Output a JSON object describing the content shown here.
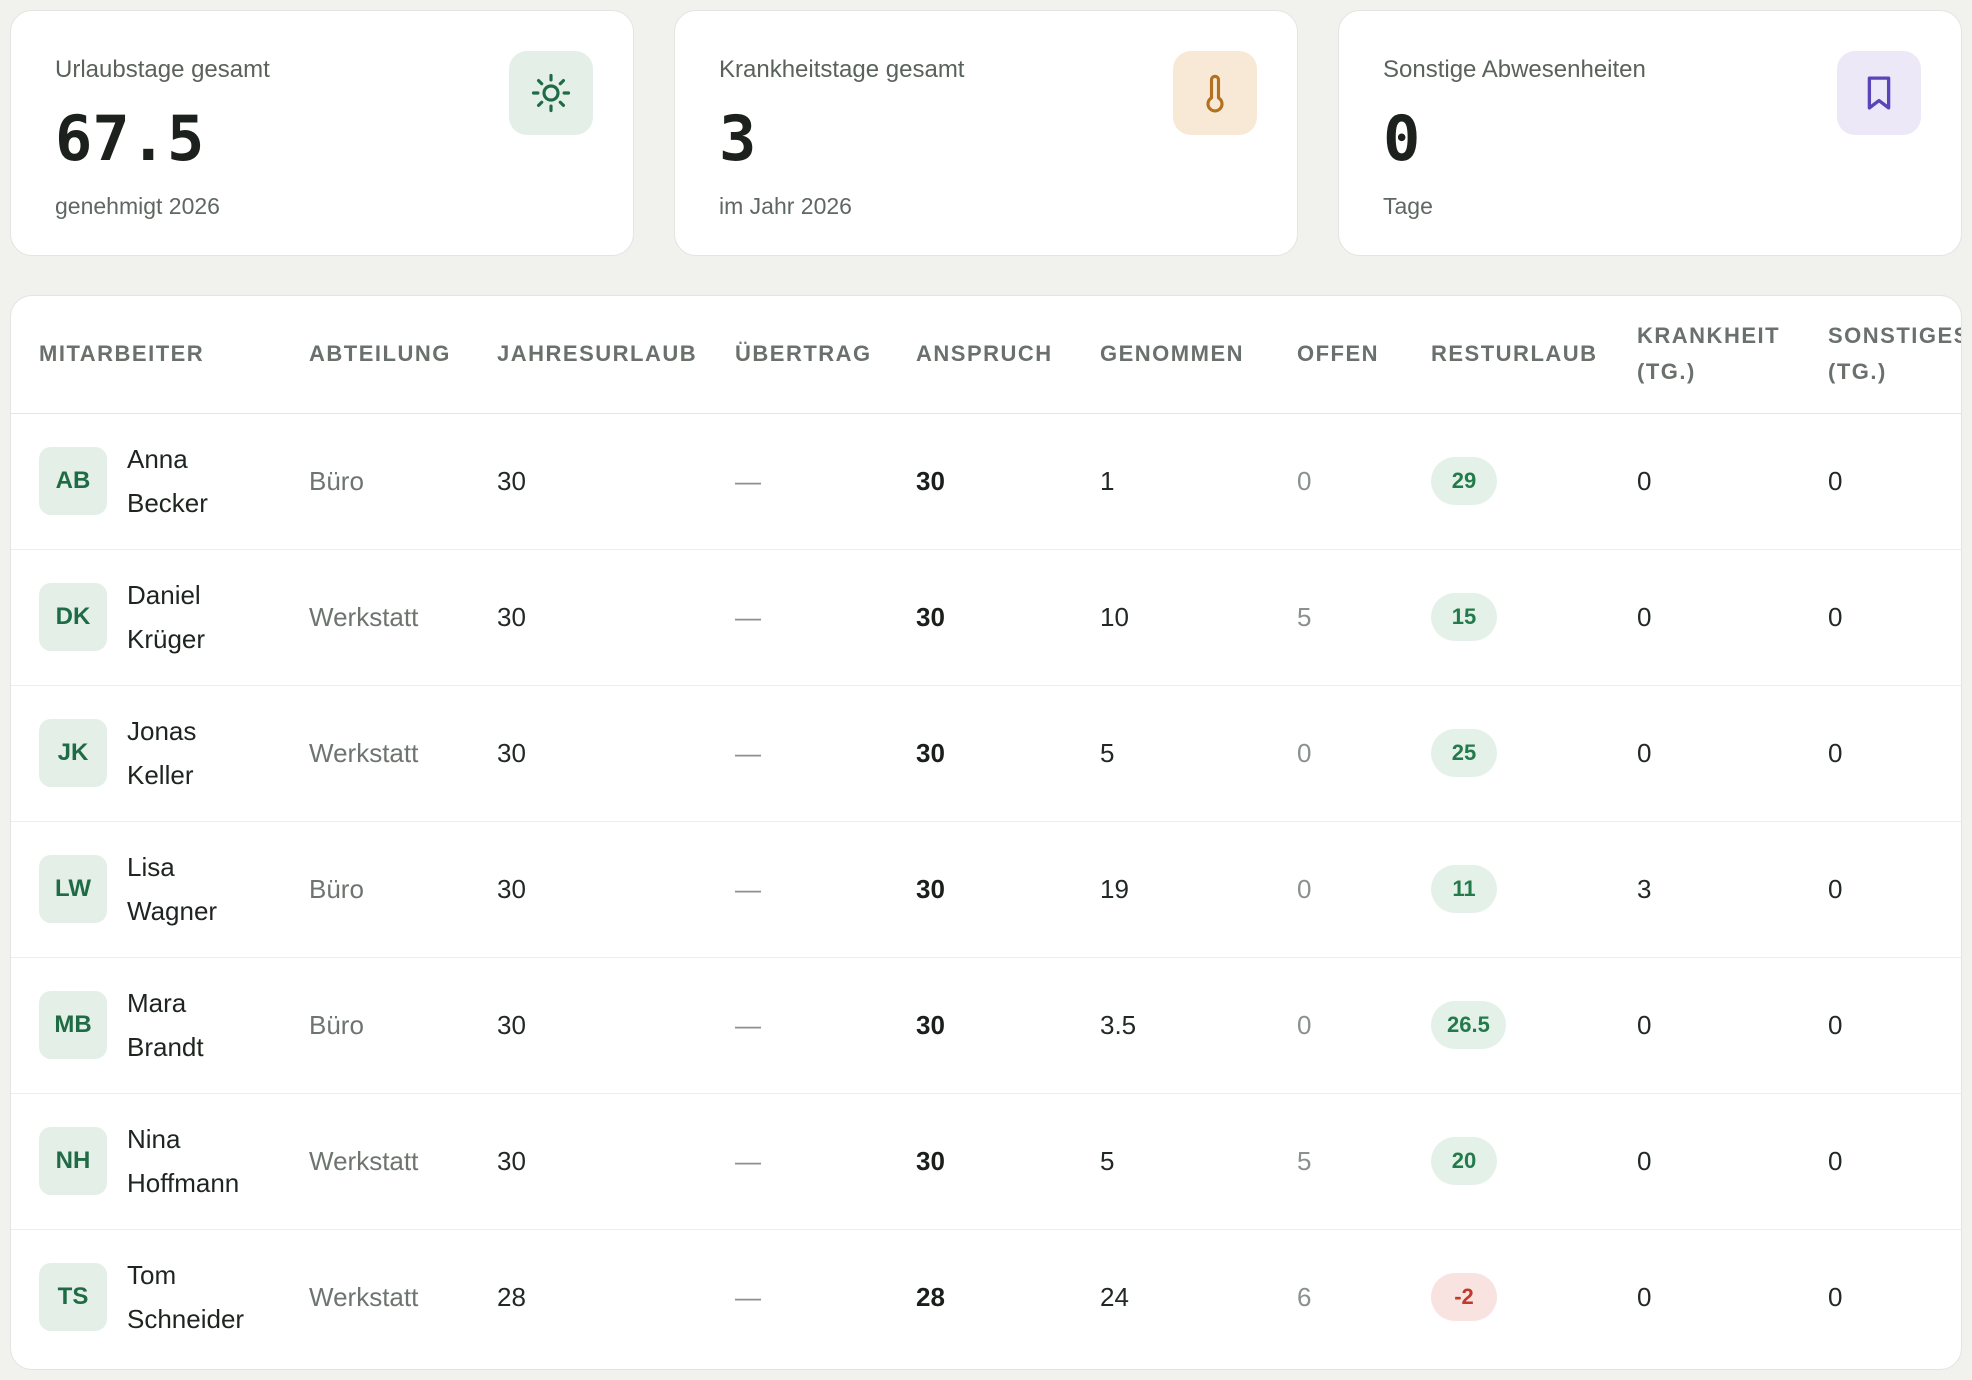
{
  "cards": [
    {
      "label": "Urlaubstage gesamt",
      "value": "67.5",
      "sub": "genehmigt 2026",
      "icon": "sun-icon",
      "icon_bg": "#e3efe7",
      "icon_color": "#1f6b45"
    },
    {
      "label": "Krankheitstage gesamt",
      "value": "3",
      "sub": "im Jahr 2026",
      "icon": "thermometer-icon",
      "icon_bg": "#f7e9d6",
      "icon_color": "#b4701e"
    },
    {
      "label": "Sonstige Abwesenheiten",
      "value": "0",
      "sub": "Tage",
      "icon": "bookmark-icon",
      "icon_bg": "#ece8f7",
      "icon_color": "#5a45b8"
    }
  ],
  "table": {
    "headers": {
      "mitarbeiter": "MITARBEITER",
      "abteilung": "ABTEILUNG",
      "jahresurlaub": "JAHRESURLAUB",
      "uebertrag": "ÜBERTRAG",
      "anspruch": "ANSPRUCH",
      "genommen": "GENOMMEN",
      "offen": "OFFEN",
      "resturlaub": "RESTURLAUB",
      "krankheit_1": "KRANKHEIT",
      "krankheit_2": "(TG.)",
      "sonstiges_1": "SONSTIGES",
      "sonstiges_2": "(TG.)"
    },
    "rows": [
      {
        "initials": "AB",
        "first": "Anna",
        "last": "Becker",
        "abteilung": "Büro",
        "jahresurlaub": "30",
        "uebertrag": "—",
        "anspruch": "30",
        "genommen": "1",
        "offen": "0",
        "resturlaub": "29",
        "negative": false,
        "krankheit": "0",
        "sonstiges": "0"
      },
      {
        "initials": "DK",
        "first": "Daniel",
        "last": "Krüger",
        "abteilung": "Werkstatt",
        "jahresurlaub": "30",
        "uebertrag": "—",
        "anspruch": "30",
        "genommen": "10",
        "offen": "5",
        "resturlaub": "15",
        "negative": false,
        "krankheit": "0",
        "sonstiges": "0"
      },
      {
        "initials": "JK",
        "first": "Jonas",
        "last": "Keller",
        "abteilung": "Werkstatt",
        "jahresurlaub": "30",
        "uebertrag": "—",
        "anspruch": "30",
        "genommen": "5",
        "offen": "0",
        "resturlaub": "25",
        "negative": false,
        "krankheit": "0",
        "sonstiges": "0"
      },
      {
        "initials": "LW",
        "first": "Lisa",
        "last": "Wagner",
        "abteilung": "Büro",
        "jahresurlaub": "30",
        "uebertrag": "—",
        "anspruch": "30",
        "genommen": "19",
        "offen": "0",
        "resturlaub": "11",
        "negative": false,
        "krankheit": "3",
        "sonstiges": "0"
      },
      {
        "initials": "MB",
        "first": "Mara",
        "last": "Brandt",
        "abteilung": "Büro",
        "jahresurlaub": "30",
        "uebertrag": "—",
        "anspruch": "30",
        "genommen": "3.5",
        "offen": "0",
        "resturlaub": "26.5",
        "negative": false,
        "krankheit": "0",
        "sonstiges": "0"
      },
      {
        "initials": "NH",
        "first": "Nina",
        "last": "Hoffmann",
        "abteilung": "Werkstatt",
        "jahresurlaub": "30",
        "uebertrag": "—",
        "anspruch": "30",
        "genommen": "5",
        "offen": "5",
        "resturlaub": "20",
        "negative": false,
        "krankheit": "0",
        "sonstiges": "0"
      },
      {
        "initials": "TS",
        "first": "Tom",
        "last": "Schneider",
        "abteilung": "Werkstatt",
        "jahresurlaub": "28",
        "uebertrag": "—",
        "anspruch": "28",
        "genommen": "24",
        "offen": "6",
        "resturlaub": "-2",
        "negative": true,
        "krankheit": "0",
        "sonstiges": "0"
      }
    ]
  }
}
